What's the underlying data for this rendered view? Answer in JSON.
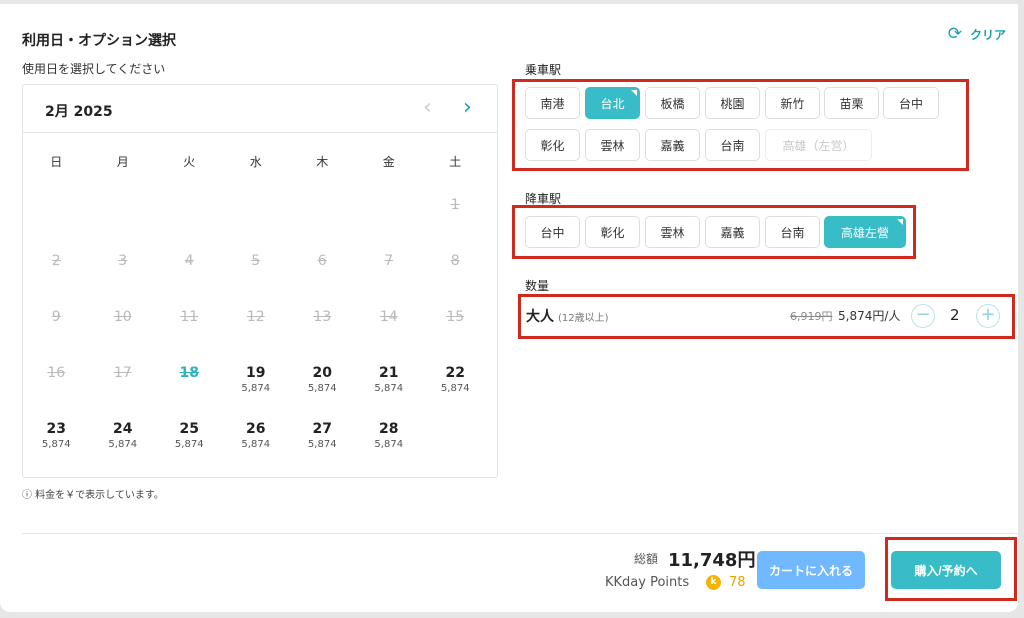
{
  "section_title": "利用日・オプション選択",
  "clear_label": "クリア",
  "clear_icon": "refresh-icon",
  "date_label": "使用日を選択してください",
  "calendar": {
    "month_label": "2月 2025",
    "weekdays": [
      "日",
      "月",
      "火",
      "水",
      "木",
      "金",
      "土"
    ],
    "rows": [
      [
        null,
        null,
        null,
        null,
        null,
        null,
        {
          "d": "1",
          "s": "dis"
        }
      ],
      [
        {
          "d": "2",
          "s": "dis"
        },
        {
          "d": "3",
          "s": "dis"
        },
        {
          "d": "4",
          "s": "dis"
        },
        {
          "d": "5",
          "s": "dis"
        },
        {
          "d": "6",
          "s": "dis"
        },
        {
          "d": "7",
          "s": "dis"
        },
        {
          "d": "8",
          "s": "dis"
        }
      ],
      [
        {
          "d": "9",
          "s": "dis"
        },
        {
          "d": "10",
          "s": "dis"
        },
        {
          "d": "11",
          "s": "dis"
        },
        {
          "d": "12",
          "s": "dis"
        },
        {
          "d": "13",
          "s": "dis"
        },
        {
          "d": "14",
          "s": "dis"
        },
        {
          "d": "15",
          "s": "dis"
        }
      ],
      [
        {
          "d": "16",
          "s": "dis"
        },
        {
          "d": "17",
          "s": "dis"
        },
        {
          "d": "18",
          "s": "today"
        },
        {
          "d": "19",
          "p": "5,874"
        },
        {
          "d": "20",
          "p": "5,874"
        },
        {
          "d": "21",
          "p": "5,874"
        },
        {
          "d": "22",
          "p": "5,874"
        }
      ],
      [
        {
          "d": "23",
          "p": "5,874"
        },
        {
          "d": "24",
          "p": "5,874"
        },
        {
          "d": "25",
          "p": "5,874"
        },
        {
          "d": "26",
          "p": "5,874"
        },
        {
          "d": "27",
          "p": "5,874"
        },
        {
          "d": "28",
          "p": "5,874"
        },
        null
      ]
    ]
  },
  "footnote": "ⓘ 料金を￥で表示しています。",
  "boarding": {
    "label": "乗車駅",
    "stations": [
      {
        "name": "南港"
      },
      {
        "name": "台北",
        "selected": true
      },
      {
        "name": "板橋"
      },
      {
        "name": "桃園"
      },
      {
        "name": "新竹"
      },
      {
        "name": "苗栗"
      },
      {
        "name": "台中"
      },
      {
        "name": "彰化"
      },
      {
        "name": "雲林"
      },
      {
        "name": "嘉義"
      },
      {
        "name": "台南"
      },
      {
        "name": "高雄（左営）",
        "disabled": true
      }
    ]
  },
  "alighting": {
    "label": "降車駅",
    "stations": [
      {
        "name": "台中"
      },
      {
        "name": "彰化"
      },
      {
        "name": "雲林"
      },
      {
        "name": "嘉義"
      },
      {
        "name": "台南"
      },
      {
        "name": "高雄左營",
        "selected": true
      }
    ]
  },
  "quantity": {
    "label": "数量",
    "name": "大人",
    "age_note": "(12歳以上)",
    "original_price": "6,919円",
    "price": "5,874円/人",
    "value": "2",
    "minus_icon": "minus-circle-icon",
    "plus_icon": "plus-circle-icon"
  },
  "footer": {
    "total_label": "総額",
    "total_value": "11,748円",
    "points_label": "KKday Points",
    "points_value": "78",
    "cart_button": "カートに入れる",
    "buy_button": "購入/予約へ"
  },
  "colors": {
    "accent": "#38bcc8",
    "cart_button": "#70b8ff",
    "highlight_box": "#d02a1f",
    "points": "#f4b400"
  }
}
